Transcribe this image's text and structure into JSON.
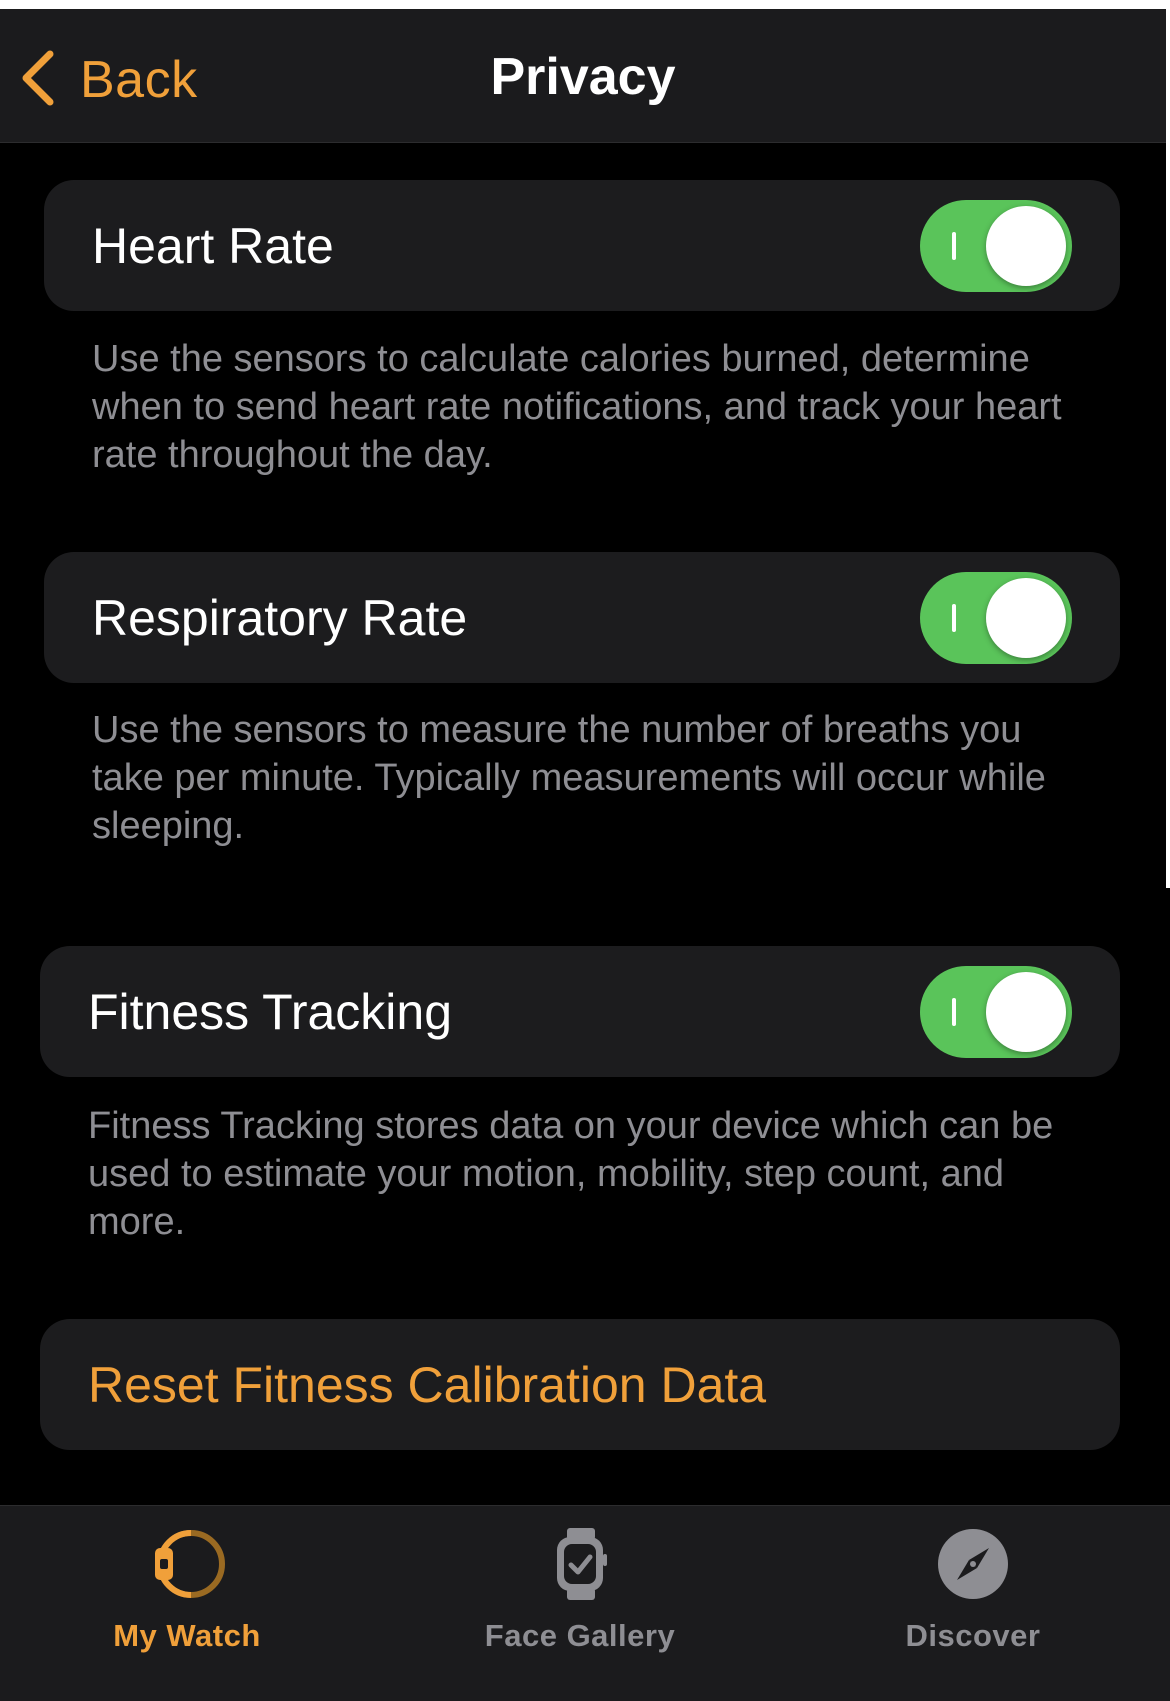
{
  "nav": {
    "back_label": "Back",
    "title": "Privacy"
  },
  "settings": [
    {
      "label": "Heart Rate",
      "enabled": true,
      "description": "Use the sensors to calculate calories burned, determine when to send heart rate notifications, and track your heart rate throughout the day."
    },
    {
      "label": "Respiratory Rate",
      "enabled": true,
      "description": "Use the sensors to measure the number of breaths you take per minute. Typically measurements will occur while sleeping."
    },
    {
      "label": "Fitness Tracking",
      "enabled": true,
      "description": "Fitness Tracking stores data on your device which can be used to estimate your motion, mobility, step count, and more."
    }
  ],
  "reset": {
    "label": "Reset Fitness Calibration Data"
  },
  "tab_bar": {
    "tabs": [
      {
        "label": "My Watch",
        "icon": "my-watch-icon",
        "active": true
      },
      {
        "label": "Face Gallery",
        "icon": "face-gallery-icon",
        "active": false
      },
      {
        "label": "Discover",
        "icon": "compass-icon",
        "active": false
      }
    ]
  },
  "colors": {
    "accent": "#f0a03a",
    "toggle_on": "#5ac45a",
    "background": "#000000",
    "card": "#1c1c1e",
    "secondary_text": "#8e8e93",
    "inactive_tab": "#8e8e93"
  }
}
